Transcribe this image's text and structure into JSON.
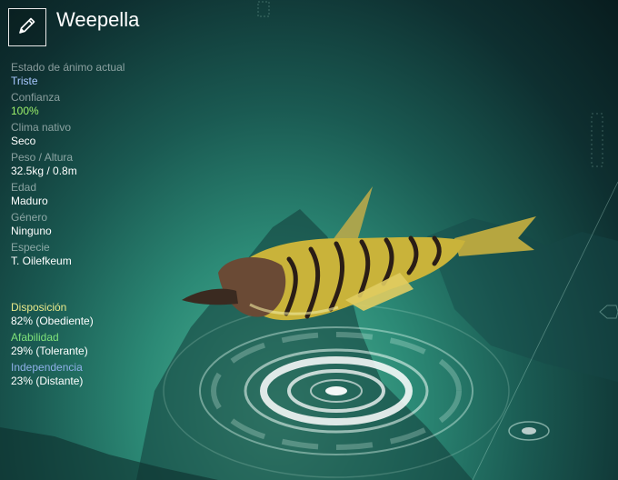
{
  "creature": {
    "name": "Weepella"
  },
  "stats": [
    {
      "label": "Estado de ánimo actual",
      "value": "Triste",
      "tone": "mood"
    },
    {
      "label": "Confianza",
      "value": "100%",
      "tone": "conf"
    },
    {
      "label": "Clima nativo",
      "value": "Seco",
      "tone": ""
    },
    {
      "label": "Peso / Altura",
      "value": "32.5kg / 0.8m",
      "tone": ""
    },
    {
      "label": "Edad",
      "value": "Maduro",
      "tone": ""
    },
    {
      "label": "Género",
      "value": "Ninguno",
      "tone": ""
    },
    {
      "label": "Especie",
      "value": "T. Oilefkeum",
      "tone": ""
    }
  ],
  "traits": [
    {
      "label": "Disposición",
      "value": "82% (Obediente)",
      "color": "#e9e98a"
    },
    {
      "label": "Afabilidad",
      "value": "29% (Tolerante)",
      "color": "#7fe27a"
    },
    {
      "label": "Independencia",
      "value": "23% (Distante)",
      "color": "#8fb0e8"
    }
  ],
  "icons": {
    "edit": "pencil-icon"
  },
  "colors": {
    "mood": "#a8c8ff",
    "trust": "#9cf06a",
    "creature_body": "#c9b33a",
    "creature_stripes": "#2a1d16"
  }
}
